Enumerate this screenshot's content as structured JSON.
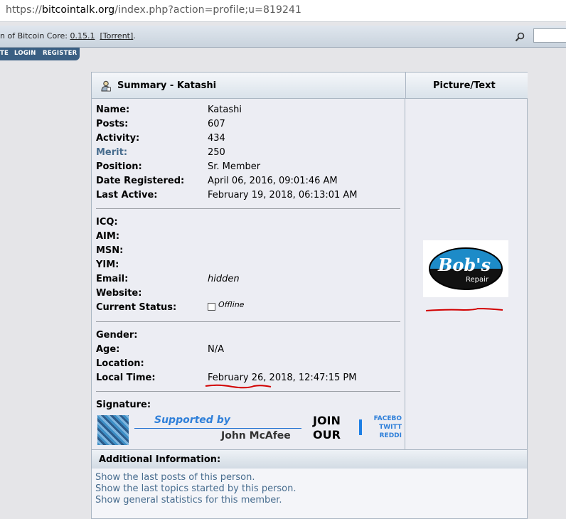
{
  "browser": {
    "url_scheme": "https://",
    "url_host": "bitcointalk.org",
    "url_path": "/index.php?action=profile;u=819241"
  },
  "topbar": {
    "news_prefix": "n of Bitcoin Core: ",
    "version_link": "0.15.1",
    "torrent_link": "[Torrent]",
    "news_suffix": "."
  },
  "nav": {
    "items": [
      "TE",
      "LOGIN",
      "REGISTER"
    ]
  },
  "summary": {
    "title": "Summary - Katashi",
    "picture_title": "Picture/Text",
    "fields1": [
      {
        "label": "Name:",
        "value": "Katashi"
      },
      {
        "label": "Posts:",
        "value": "607"
      },
      {
        "label": "Activity:",
        "value": "434"
      },
      {
        "label": "Merit:",
        "value": "250"
      },
      {
        "label": "Position:",
        "value": "Sr. Member"
      },
      {
        "label": "Date Registered:",
        "value": "April 06, 2016, 09:01:46 AM"
      },
      {
        "label": "Last Active:",
        "value": "February 19, 2018, 06:13:01 AM"
      }
    ],
    "fields2": [
      {
        "label": "ICQ:",
        "value": ""
      },
      {
        "label": "AIM:",
        "value": ""
      },
      {
        "label": "MSN:",
        "value": ""
      },
      {
        "label": "YIM:",
        "value": ""
      },
      {
        "label": "Email:",
        "value": "hidden"
      },
      {
        "label": "Website:",
        "value": ""
      },
      {
        "label": "Current Status:",
        "value": "Offline"
      }
    ],
    "fields3": [
      {
        "label": "Gender:",
        "value": ""
      },
      {
        "label": "Age:",
        "value": "N/A"
      },
      {
        "label": "Location:",
        "value": ""
      },
      {
        "label": "Local Time:",
        "value": "February 26, 2018, 12:47:15 PM"
      }
    ],
    "signature_label": "Signature:",
    "signature": {
      "supported_by": "Supported by",
      "name": "John McAfee",
      "join_line1": "JOIN",
      "join_line2": "OUR",
      "social": [
        "FACEBO",
        "TWITT",
        "REDDI"
      ]
    },
    "avatar_text": {
      "line1": "Bob's",
      "line2": "Repair"
    }
  },
  "additional": {
    "title": "Additional Information:",
    "links": [
      "Show the last posts of this person.",
      "Show the last topics started by this person.",
      "Show general statistics for this member."
    ]
  },
  "colors": {
    "accent": "#476c8e",
    "nav": "#3a5f83",
    "annotation": "#d20000"
  }
}
